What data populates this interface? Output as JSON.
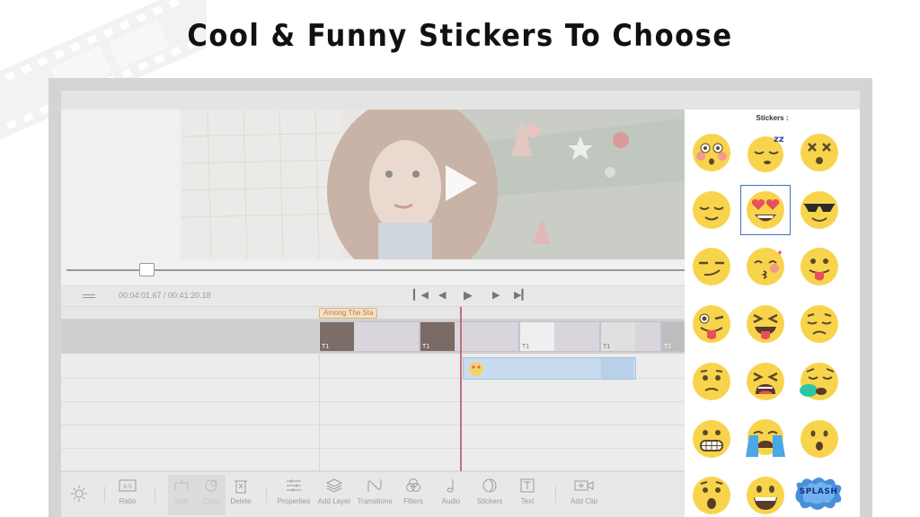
{
  "headline": "Cool & Funny Stickers To Choose",
  "player": {
    "timecode": "00:04:01.67 / 00:41:20.18",
    "progress_fraction": 0.12
  },
  "timeline": {
    "clip_label": "Among The Sta",
    "track_labels": [
      "T1",
      "T1",
      "T1",
      "T1",
      "T1"
    ]
  },
  "toolbar": {
    "ratio": "Ratio",
    "split": "Split",
    "copy": "Copy",
    "delete": "Delete",
    "properties": "Properties",
    "add_layer": "Add Layer",
    "transitions": "Transitions",
    "filters": "Filters",
    "audio": "Audio",
    "stickers": "Stickers",
    "text": "Text",
    "add_clip": "Add Clip"
  },
  "stickers_panel": {
    "title": "Stickers :",
    "items": [
      "flushed-emoji",
      "sleeping-emoji",
      "dizzy-emoji",
      "relieved-emoji",
      "heart-eyes-emoji",
      "sunglasses-emoji",
      "smirk-emoji",
      "kissing-blush-emoji",
      "tongue-out-emoji",
      "winking-tongue-emoji",
      "squinting-tongue-emoji",
      "disappointed-emoji",
      "confused-emoji",
      "tired-emoji",
      "sleepy-mask-emoji",
      "grimacing-emoji",
      "crying-emoji",
      "hushed-emoji",
      "astonished-emoji",
      "grinning-emoji",
      "splash-sticker"
    ],
    "selected_index": 4,
    "splash_text": "SPLASH"
  },
  "colors": {
    "emoji_yellow": "#f8d44c",
    "accent_blue": "#3a73c2",
    "playhead": "#c0707a"
  }
}
